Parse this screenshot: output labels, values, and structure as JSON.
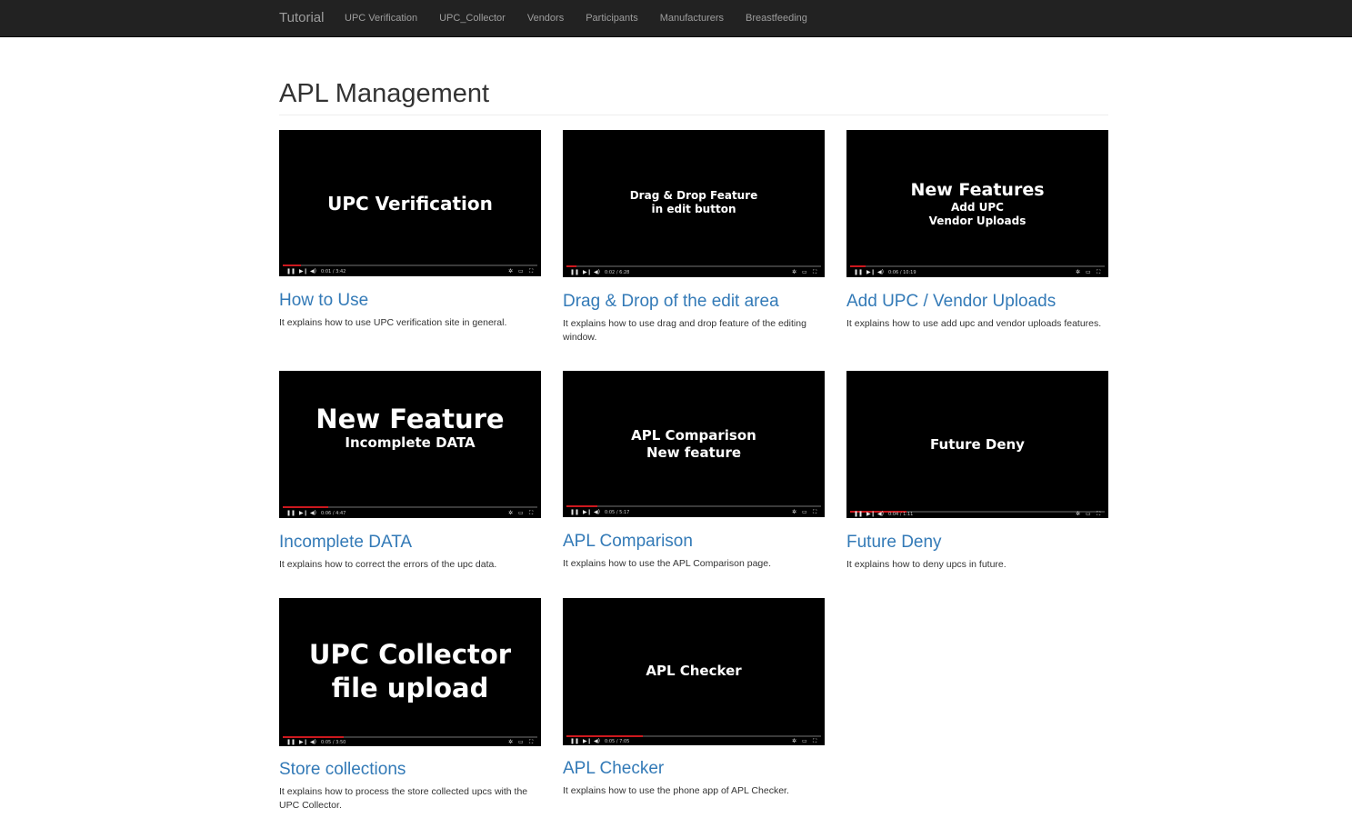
{
  "navbar": {
    "brand": "Tutorial",
    "links": [
      "UPC Verification",
      "UPC_Collector",
      "Vendors",
      "Participants",
      "Manufacturers",
      "Breastfeeding"
    ]
  },
  "page": {
    "title": "APL Management"
  },
  "cards": [
    {
      "video_lines": [
        "UPC Verification"
      ],
      "time": "0:01 / 3:42",
      "progress": 0.07,
      "title": "How to Use",
      "description": "It explains how to use UPC verification site in general."
    },
    {
      "video_lines": [
        "Drag & Drop Feature",
        "in edit button"
      ],
      "time": "0:02 / 6:28",
      "progress": 0.04,
      "title": "Drag & Drop of the edit area",
      "description": "It explains how to use drag and drop feature of the editing window."
    },
    {
      "video_lines": [
        "New Features",
        "Add UPC",
        "Vendor Uploads"
      ],
      "time": "0:06 / 10:19",
      "progress": 0.06,
      "title": "Add UPC / Vendor Uploads",
      "description": "It explains how to use add upc and vendor uploads features."
    },
    {
      "video_lines": [
        "New Feature",
        "Incomplete DATA"
      ],
      "time": "0:06 / 4:47",
      "progress": 0.18,
      "title": "Incomplete DATA",
      "description": "It explains how to correct the errors of the upc data."
    },
    {
      "video_lines": [
        "APL Comparison",
        "New feature"
      ],
      "time": "0:05 / 5:17",
      "progress": 0.12,
      "title": "APL Comparison",
      "description": "It explains how to use the APL Comparison page."
    },
    {
      "video_lines": [
        "Future Deny"
      ],
      "time": "0:04 / 1:11",
      "progress": 0.22,
      "title": "Future Deny",
      "description": "It explains how to deny upcs in future."
    },
    {
      "video_lines": [
        "UPC Collector",
        "file upload"
      ],
      "time": "0:05 / 3:50",
      "progress": 0.24,
      "title": "Store collections",
      "description": "It explains how to process the store collected upcs with the UPC Collector."
    },
    {
      "video_lines": [
        "APL Checker"
      ],
      "time": "0:05 / 7:05",
      "progress": 0.3,
      "title": "APL Checker",
      "description": "It explains how to use the phone app of APL Checker."
    }
  ],
  "colors": {
    "navbar_bg": "#222222",
    "nav_link": "#9d9d9d",
    "link": "#337ab7",
    "progress_played": "#cc181e"
  },
  "icons": [
    "play-pause-icon",
    "next-icon",
    "volume-icon",
    "settings-icon",
    "theater-icon",
    "fullscreen-icon"
  ]
}
